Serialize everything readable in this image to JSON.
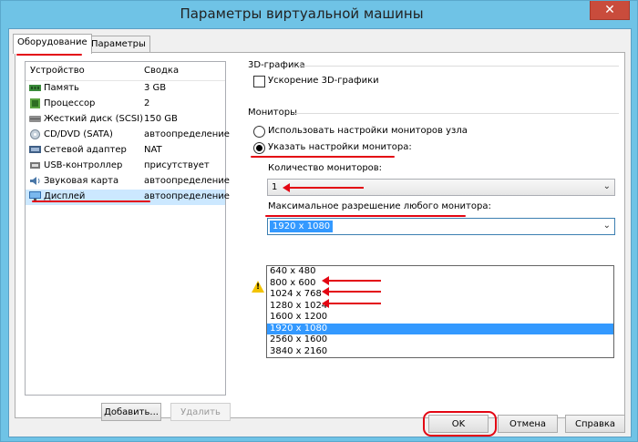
{
  "window": {
    "title": "Параметры виртуальной машины"
  },
  "tabs": [
    {
      "label": "Оборудование"
    },
    {
      "label": "Параметры"
    }
  ],
  "device_list": {
    "columns": {
      "device": "Устройство",
      "summary": "Сводка"
    },
    "items": [
      {
        "name": "Память",
        "summary": "3 GB",
        "icon": "memory-icon"
      },
      {
        "name": "Процессор",
        "summary": "2",
        "icon": "cpu-icon"
      },
      {
        "name": "Жесткий диск (SCSI)",
        "summary": "150 GB",
        "icon": "hard-disk-icon"
      },
      {
        "name": "CD/DVD (SATA)",
        "summary": "автоопределение",
        "icon": "cd-dvd-icon"
      },
      {
        "name": "Сетевой адаптер",
        "summary": "NAT",
        "icon": "network-icon"
      },
      {
        "name": "USB-контроллер",
        "summary": "присутствует",
        "icon": "usb-icon"
      },
      {
        "name": "Звуковая карта",
        "summary": "автоопределение",
        "icon": "speaker-icon"
      },
      {
        "name": "Дисплей",
        "summary": "автоопределение",
        "icon": "display-icon"
      }
    ],
    "add_label": "Добавить...",
    "remove_label": "Удалить"
  },
  "graphics3d": {
    "group_label": "3D-графика",
    "accel_label": "Ускорение 3D-графики",
    "accel_checked": false
  },
  "monitors": {
    "group_label": "Мониторы",
    "use_host_label": "Использовать настройки мониторов узла",
    "specify_label": "Указать настройки монитора:",
    "count_label": "Количество мониторов:",
    "count_value": "1",
    "max_res_label": "Максимальное разрешение любого монитора:",
    "max_res_value": "1920 x 1080",
    "res_options": [
      "640 x 480",
      "800 x 600",
      "1024 x 768",
      "1280 x 1024",
      "1600 x 1200",
      "1920 x 1080",
      "2560 x 1600",
      "3840 x 2160"
    ]
  },
  "footer": {
    "ok_label": "OK",
    "cancel_label": "Отмена",
    "help_label": "Справка"
  },
  "colors": {
    "accent": "#3399ff",
    "annotation": "#e30613",
    "frame": "#6fc3e6"
  }
}
